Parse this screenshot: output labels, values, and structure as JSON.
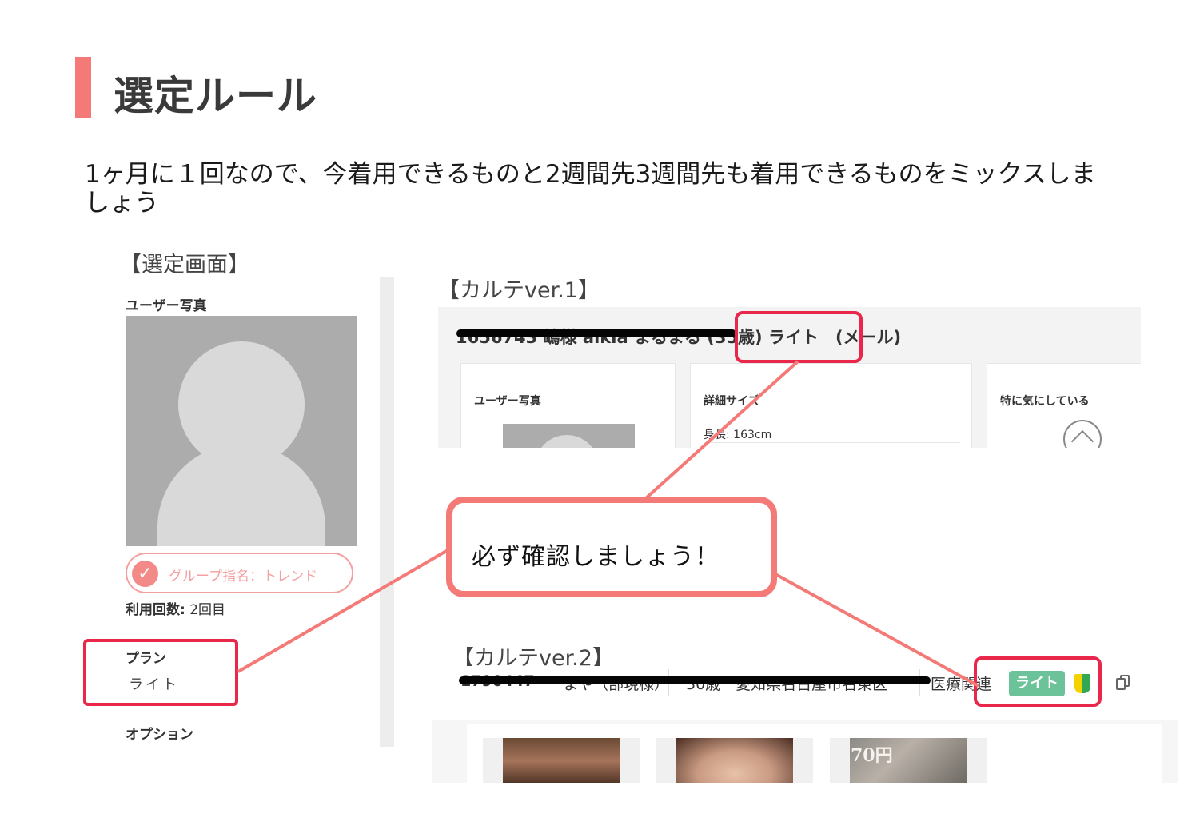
{
  "slide": {
    "title": "選定ルール",
    "intro": "1ヶ月に１回なので、今着用できるものと2週間先3週間先も着用できるものをミックスしましょう"
  },
  "labels": {
    "selection_screen": "【選定画面】",
    "karte_v1": "【カルテver.1】",
    "karte_v2": "【カルテver.2】"
  },
  "selection": {
    "photo_heading": "ユーザー写真",
    "group_tag": "グループ指名：トレンド",
    "usage_label": "利用回数:",
    "usage_value": "2回目",
    "plan_heading": "プラン",
    "plan_value": "ライト",
    "option_heading": "オプション"
  },
  "karte_v1": {
    "header_text": "1656743 嶋様 aikia まるまる (35歳) ライト　(メール)",
    "cards": [
      {
        "title": "ユーザー写真"
      },
      {
        "title": "詳細サイズ",
        "value": "身長: 163cm"
      },
      {
        "title": "特に気にしている"
      }
    ]
  },
  "karte_v2": {
    "id": "1790447",
    "name": "まや（部現様）",
    "age_area": "30歳　愛知県名古屋市名東区",
    "occupation": "医療関連",
    "plan_badge": "ライト",
    "thumb_price": "70円"
  },
  "callout": {
    "text": "必ず確認しましょう！"
  },
  "colors": {
    "accent": "#f47a78",
    "highlight": "#e8274a",
    "badge": "#6cc39a"
  }
}
